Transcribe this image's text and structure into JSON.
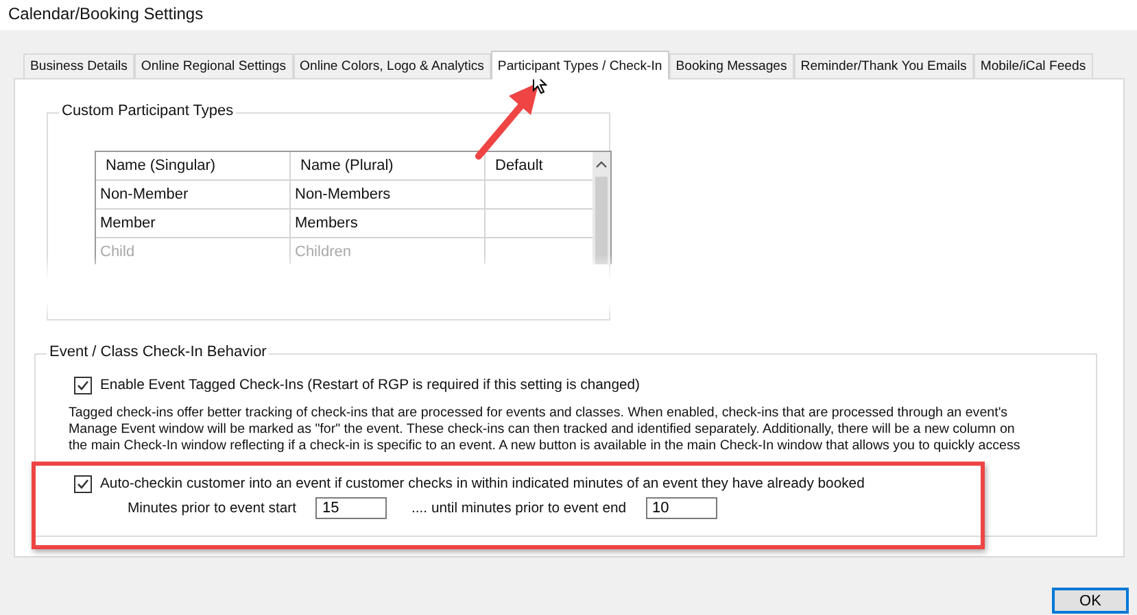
{
  "window": {
    "title": "Calendar/Booking Settings"
  },
  "tabs": [
    {
      "label": "Business Details",
      "selected": false
    },
    {
      "label": "Online Regional Settings",
      "selected": false
    },
    {
      "label": "Online Colors, Logo & Analytics",
      "selected": false
    },
    {
      "label": "Participant Types / Check-In",
      "selected": true
    },
    {
      "label": "Booking Messages",
      "selected": false
    },
    {
      "label": "Reminder/Thank You Emails",
      "selected": false
    },
    {
      "label": "Mobile/iCal Feeds",
      "selected": false
    }
  ],
  "participant_types": {
    "title": "Custom Participant Types",
    "columns": [
      "Name (Singular)",
      "Name (Plural)",
      "Default"
    ],
    "rows": [
      {
        "cells": [
          "Non-Member",
          "Non-Members",
          ""
        ],
        "faded": false
      },
      {
        "cells": [
          "Member",
          "Members",
          ""
        ],
        "faded": false
      },
      {
        "cells": [
          "Child",
          "Children",
          ""
        ],
        "faded": true
      }
    ]
  },
  "check_in": {
    "title": "Event / Class Check-In Behavior",
    "enable_tagged": {
      "label": "Enable Event Tagged Check-Ins (Restart of RGP is required if this setting is changed)",
      "checked": true
    },
    "description_lines": [
      "Tagged check-ins offer better tracking of check-ins that are processed for events and classes.   When enabled, check-ins that are processed through an event's",
      "Manage Event window will be marked as \"for\" the event.   These check-ins can then tracked and identified separately.    Additionally, there will be a new column on",
      "the main Check-In window reflecting if a check-in is specific to an event.   A new button is available in the main Check-In window that allows you to quickly access"
    ],
    "auto_checkin": {
      "label": "Auto-checkin customer into an event if customer checks in within indicated minutes of an event they have already booked",
      "checked": true
    },
    "minutes_before_label": "Minutes prior to event start",
    "minutes_before": "15",
    "minutes_after_label": ".... until minutes prior to event end",
    "minutes_after": "10"
  },
  "buttons": [
    "OK"
  ]
}
